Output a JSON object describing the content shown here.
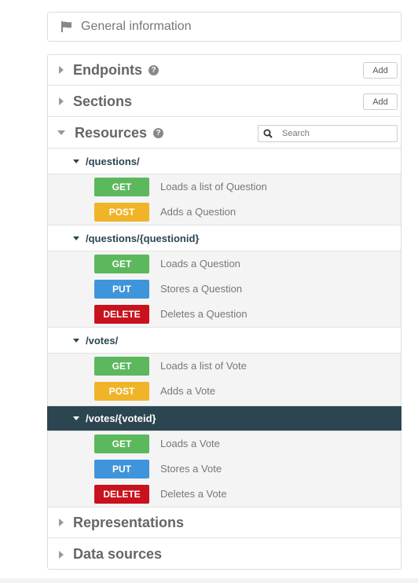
{
  "general": {
    "label": "General information",
    "icon": "flag-icon"
  },
  "sections": {
    "endpoints": {
      "title": "Endpoints",
      "add_label": "Add"
    },
    "sections": {
      "title": "Sections",
      "add_label": "Add"
    },
    "resources": {
      "title": "Resources",
      "search_placeholder": "Search"
    },
    "representations": {
      "title": "Representations"
    },
    "data_sources": {
      "title": "Data sources"
    }
  },
  "resources": [
    {
      "path": "/questions/",
      "methods": [
        {
          "verb": "GET",
          "desc": "Loads a list of Question"
        },
        {
          "verb": "POST",
          "desc": "Adds a Question"
        }
      ]
    },
    {
      "path": "/questions/{questionid}",
      "methods": [
        {
          "verb": "GET",
          "desc": "Loads a Question"
        },
        {
          "verb": "PUT",
          "desc": "Stores a Question"
        },
        {
          "verb": "DELETE",
          "desc": "Deletes a Question"
        }
      ]
    },
    {
      "path": "/votes/",
      "methods": [
        {
          "verb": "GET",
          "desc": "Loads a list of Vote"
        },
        {
          "verb": "POST",
          "desc": "Adds a Vote"
        }
      ]
    },
    {
      "path": "/votes/{voteid}",
      "selected": true,
      "methods": [
        {
          "verb": "GET",
          "desc": "Loads a Vote"
        },
        {
          "verb": "PUT",
          "desc": "Stores a Vote"
        },
        {
          "verb": "DELETE",
          "desc": "Deletes a Vote"
        }
      ]
    }
  ],
  "colors": {
    "get": "#5cb85c",
    "post": "#f0b429",
    "put": "#3f95db",
    "delete": "#c9121d",
    "selected_row": "#2c4651"
  }
}
